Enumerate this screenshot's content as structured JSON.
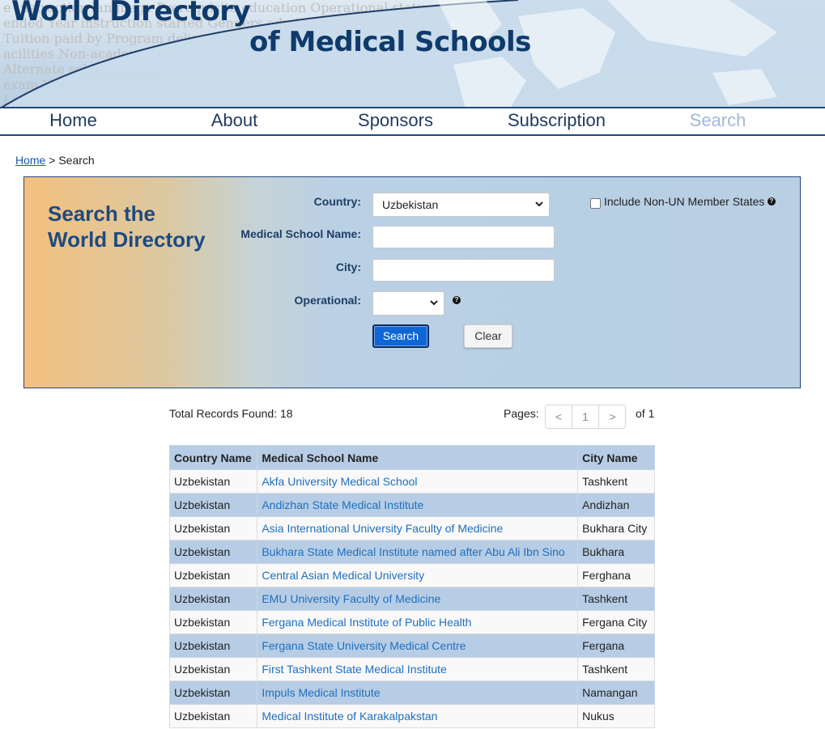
{
  "banner": {
    "title_line1": "World Directory",
    "title_line2": "of Medical Schools",
    "background_text": [
      "e       Instruction language    Prerequisite education    Operational status",
      "ended        Year instruction started    Genders admitted",
      "Tuition paid by    Program delivery in other countries",
      "acilities    Non-academic affiliations",
      "Alternate school names",
      "exam    Y",
      "La"
    ]
  },
  "nav": {
    "items": [
      {
        "label": "Home",
        "active": false
      },
      {
        "label": "About",
        "active": false
      },
      {
        "label": "Sponsors",
        "active": false
      },
      {
        "label": "Subscription",
        "active": false
      },
      {
        "label": "Search",
        "active": true
      }
    ]
  },
  "breadcrumb": {
    "home_label": "Home",
    "separator": " > ",
    "current": "Search"
  },
  "search": {
    "title_line1": "Search the",
    "title_line2": "World Directory",
    "country_label": "Country:",
    "country_value": "Uzbekistan",
    "school_name_label": "Medical School Name:",
    "school_name_value": "",
    "city_label": "City:",
    "city_value": "",
    "operational_label": "Operational:",
    "operational_value": "",
    "non_un_label": "Include Non-UN Member States",
    "non_un_checked": false,
    "search_button": "Search",
    "clear_button": "Clear",
    "help_glyph": "?"
  },
  "results": {
    "total_label": "Total Records Found: 18",
    "pages_label": "Pages:",
    "prev": "<",
    "current_page": "1",
    "next": ">",
    "of_label": "of 1",
    "columns": [
      "Country Name",
      "Medical School Name",
      "City Name"
    ],
    "rows": [
      {
        "country": "Uzbekistan",
        "school": "Akfa University Medical School",
        "city": "Tashkent"
      },
      {
        "country": "Uzbekistan",
        "school": "Andizhan State Medical Institute",
        "city": "Andizhan"
      },
      {
        "country": "Uzbekistan",
        "school": "Asia International University Faculty of Medicine",
        "city": "Bukhara City"
      },
      {
        "country": "Uzbekistan",
        "school": "Bukhara State Medical Institute named after Abu Ali Ibn Sino",
        "city": "Bukhara"
      },
      {
        "country": "Uzbekistan",
        "school": "Central Asian Medical University",
        "city": "Ferghana"
      },
      {
        "country": "Uzbekistan",
        "school": "EMU University Faculty of Medicine",
        "city": "Tashkent"
      },
      {
        "country": "Uzbekistan",
        "school": "Fergana Medical Institute of Public Health",
        "city": "Fergana City"
      },
      {
        "country": "Uzbekistan",
        "school": "Fergana State University Medical Centre",
        "city": "Fergana"
      },
      {
        "country": "Uzbekistan",
        "school": "First Tashkent State Medical Institute",
        "city": "Tashkent"
      },
      {
        "country": "Uzbekistan",
        "school": "Impuls Medical Institute",
        "city": "Namangan"
      },
      {
        "country": "Uzbekistan",
        "school": "Medical Institute of Karakalpakstan",
        "city": "Nukus"
      }
    ]
  },
  "colors": {
    "brand_navy": "#0f3a6b",
    "header_blue": "#b7cde5",
    "link_blue": "#1f6fbf",
    "search_button": "#1166d6"
  }
}
